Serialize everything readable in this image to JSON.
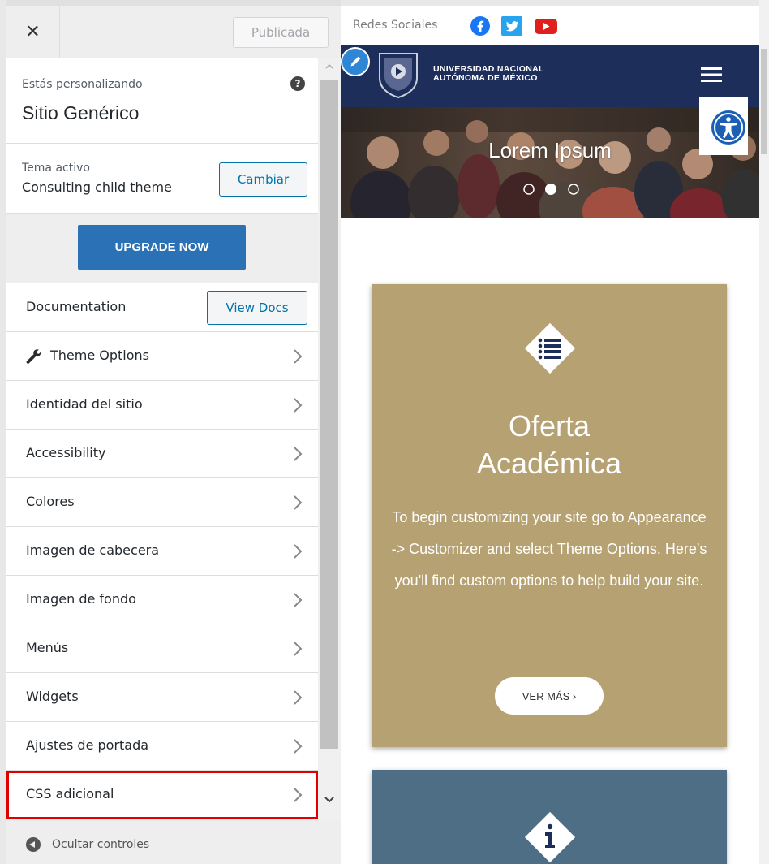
{
  "panel": {
    "close_symbol": "✕",
    "publish_label": "Publicada",
    "info": {
      "small": "Estás personalizando",
      "site": "Sitio Genérico",
      "help": "?"
    },
    "theme": {
      "label": "Tema activo",
      "name": "Consulting child theme",
      "change_label": "Cambiar"
    },
    "upgrade_label": "UPGRADE NOW",
    "docs": {
      "label": "Documentation",
      "button": "View Docs"
    },
    "items": [
      {
        "label": "Theme Options"
      },
      {
        "label": "Identidad del sitio"
      },
      {
        "label": "Accessibility"
      },
      {
        "label": "Colores"
      },
      {
        "label": "Imagen de cabecera"
      },
      {
        "label": "Imagen de fondo"
      },
      {
        "label": "Menús"
      },
      {
        "label": "Widgets"
      },
      {
        "label": "Ajustes de portada"
      },
      {
        "label": "CSS adicional"
      }
    ],
    "hide_label": "Ocultar controles",
    "highlight_color": "#e00000"
  },
  "preview": {
    "social_label": "Redes Sociales",
    "social_icons": [
      "facebook-icon",
      "twitter-icon",
      "youtube-icon"
    ],
    "university": {
      "line1": "UNIVERSIDAD NACIONAL",
      "line2": "AUTÓNOMA DE MÉXICO"
    },
    "hero": {
      "title": "Lorem Ipsum",
      "active_slide": 2,
      "slide_count": 3
    },
    "card1": {
      "title_line1": "Oferta",
      "title_line2": "Académica",
      "text": "To begin customizing your site go to Appearance -> Customizer and select Theme Options. Here's you'll find custom options to help build your site.",
      "button": "VER MÁS ›",
      "color": "#b6a173"
    },
    "card2": {
      "color": "#4d6e85"
    }
  }
}
